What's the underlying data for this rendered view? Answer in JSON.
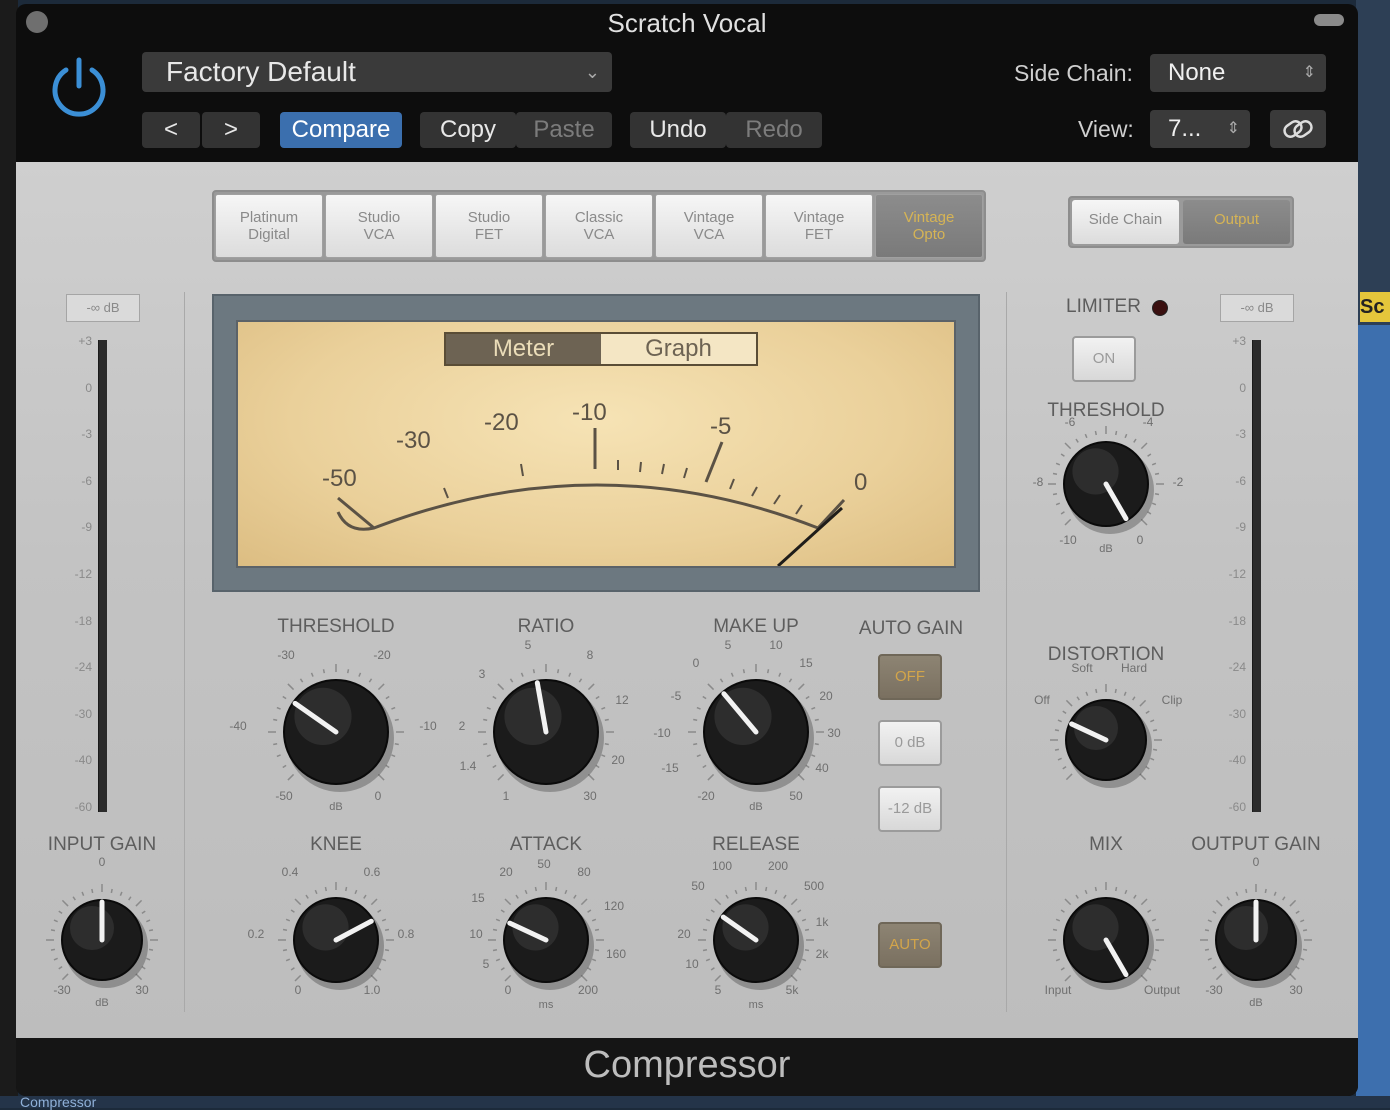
{
  "window": {
    "title": "Scratch Vocal",
    "plugin_name": "Compressor"
  },
  "header": {
    "preset": "Factory Default",
    "prev_label": "<",
    "next_label": ">",
    "compare_label": "Compare",
    "copy_label": "Copy",
    "paste_label": "Paste",
    "undo_label": "Undo",
    "redo_label": "Redo",
    "side_chain_label": "Side Chain:",
    "side_chain_value": "None",
    "view_label": "View:",
    "view_value": "7..."
  },
  "circuit_types": [
    {
      "label": "Platinum\nDigital",
      "selected": false
    },
    {
      "label": "Studio\nVCA",
      "selected": false
    },
    {
      "label": "Studio\nFET",
      "selected": false
    },
    {
      "label": "Classic\nVCA",
      "selected": false
    },
    {
      "label": "Vintage\nVCA",
      "selected": false
    },
    {
      "label": "Vintage\nFET",
      "selected": false
    },
    {
      "label": "Vintage\nOpto",
      "selected": true
    }
  ],
  "monitor_toggle": {
    "side_chain": "Side Chain",
    "output": "Output",
    "selected": "Output"
  },
  "meter": {
    "tabs": [
      "Meter",
      "Graph"
    ],
    "selected_tab": "Meter",
    "scale": [
      "-50",
      "-30",
      "-20",
      "-10",
      "-5",
      "0"
    ]
  },
  "input_meter": {
    "peak": "-∞ dB",
    "ticks": [
      "+3",
      "0",
      "-3",
      "-6",
      "-9",
      "-12",
      "-18",
      "-24",
      "-30",
      "-40",
      "-60"
    ]
  },
  "output_meter": {
    "peak": "-∞ dB",
    "ticks": [
      "+3",
      "0",
      "-3",
      "-6",
      "-9",
      "-12",
      "-18",
      "-24",
      "-30",
      "-40",
      "-60"
    ]
  },
  "knobs": {
    "threshold": {
      "label": "THRESHOLD",
      "unit": "dB",
      "ticks": [
        "-30",
        "-20",
        "-10",
        "0",
        "-50",
        "-40"
      ]
    },
    "ratio": {
      "label": "RATIO",
      "ticks": [
        "5",
        "8",
        "12",
        "20",
        "30",
        "1",
        "1.4",
        "2",
        "3"
      ]
    },
    "makeup": {
      "label": "MAKE UP",
      "unit": "dB",
      "ticks": [
        "0",
        "5",
        "10",
        "15",
        "20",
        "30",
        "40",
        "50",
        "-20",
        "-15",
        "-10",
        "-5"
      ]
    },
    "knee": {
      "label": "KNEE",
      "ticks": [
        "0.4",
        "0.6",
        "0.8",
        "1.0",
        "0",
        "0.2"
      ]
    },
    "attack": {
      "label": "ATTACK",
      "unit": "ms",
      "ticks": [
        "50",
        "80",
        "120",
        "160",
        "200",
        "0",
        "5",
        "10",
        "15",
        "20"
      ]
    },
    "release": {
      "label": "RELEASE",
      "unit": "ms",
      "ticks": [
        "100",
        "200",
        "500",
        "1k",
        "2k",
        "5k",
        "5",
        "10",
        "20",
        "50"
      ]
    },
    "input_gain": {
      "label": "INPUT GAIN",
      "unit": "dB",
      "ticks": [
        "0",
        "-30",
        "30"
      ]
    },
    "output_gain": {
      "label": "OUTPUT GAIN",
      "unit": "dB",
      "ticks": [
        "0",
        "-30",
        "30"
      ]
    },
    "limiter_threshold": {
      "label": "THRESHOLD",
      "unit": "dB",
      "ticks": [
        "-6",
        "-4",
        "-2",
        "0",
        "-10",
        "-8"
      ]
    },
    "distortion": {
      "label": "DISTORTION",
      "ticks": [
        "Off",
        "Soft",
        "Hard",
        "Clip"
      ]
    },
    "mix": {
      "label": "MIX",
      "ticks": [
        "Input",
        "Output"
      ]
    }
  },
  "auto_gain": {
    "label": "AUTO GAIN",
    "options": [
      "OFF",
      "0 dB",
      "-12 dB"
    ],
    "selected": "OFF",
    "auto_button": "AUTO"
  },
  "limiter": {
    "label": "LIMITER",
    "on_label": "ON"
  },
  "colors": {
    "accent_blue": "#3b6fae",
    "selected_gold": "#d6b455",
    "meter_face": "#ead09a"
  }
}
